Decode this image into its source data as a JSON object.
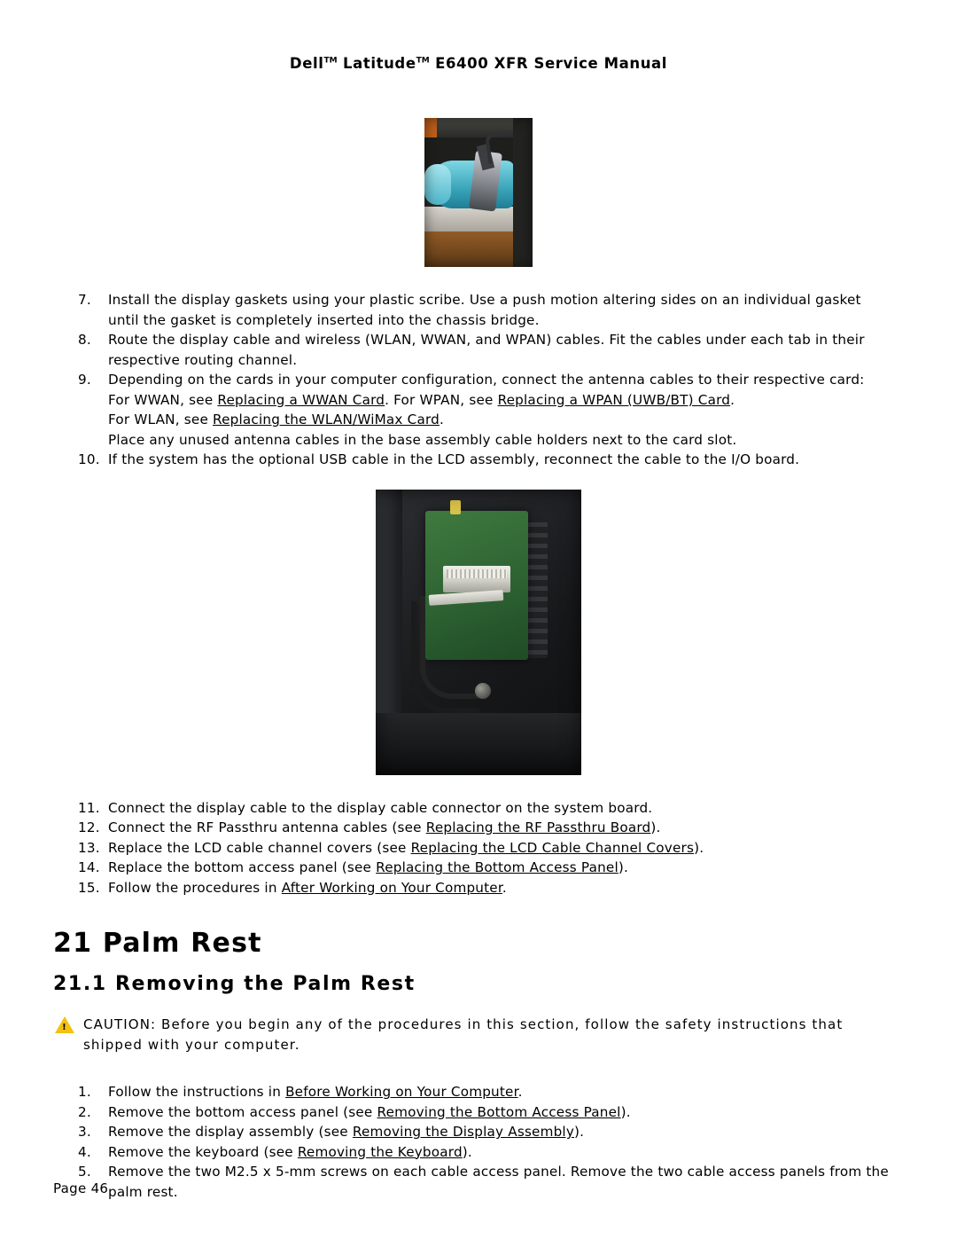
{
  "header": {
    "title_part1": "Dell",
    "tm1": "TM",
    "title_part2": "Latitude",
    "tm2": "TM",
    "title_part3": " E6400 XFR Service Manual"
  },
  "figures": {
    "fig1_name": "display-gasket-photo",
    "fig2_name": "io-board-usb-cable-photo"
  },
  "steps_group1": [
    {
      "num": "7.",
      "text": "Install the display gaskets using your plastic scribe.  Use a push motion altering sides on an individual gasket until the gasket is completely inserted into the chassis bridge."
    },
    {
      "num": "8.",
      "text": "Route the display cable and wireless (WLAN, WWAN, and WPAN) cables. Fit the cables under each tab in their respective routing channel."
    },
    {
      "num": "9.",
      "text_pre": "Depending on the cards in your computer configuration, connect the antenna cables to their respective card:",
      "line2_pre": "For WWAN, see ",
      "link1": "Replacing a WWAN Card",
      "line2_mid": ".  For WPAN, see ",
      "link2": "Replacing a WPAN (UWB/BT) Card",
      "line2_post": ".",
      "line3_pre": "For WLAN, see ",
      "link3": "Replacing the WLAN/WiMax Card",
      "line3_post": ".",
      "line4": "Place any unused antenna cables in the base assembly cable holders next to the card slot."
    },
    {
      "num": "10.",
      "text": "If the system has the optional USB cable in the LCD assembly, reconnect the cable to the I/O board."
    }
  ],
  "steps_group2": [
    {
      "num": "11.",
      "text": "Connect the display cable to the display cable connector on the system board."
    },
    {
      "num": "12.",
      "pre": "Connect the RF Passthru antenna cables (see ",
      "link": "Replacing the RF Passthru Board",
      "post": ")."
    },
    {
      "num": "13.",
      "pre": "Replace the LCD cable channel covers (see ",
      "link": "Replacing the LCD Cable Channel Covers",
      "post": ")."
    },
    {
      "num": "14.",
      "pre": "Replace the bottom access panel (see ",
      "link": "Replacing the Bottom Access Panel",
      "post": ")."
    },
    {
      "num": "15.",
      "pre": "Follow the procedures in ",
      "link": "After Working on Your Computer",
      "post": "."
    }
  ],
  "section": {
    "number": "21",
    "title": "Palm Rest",
    "subsection_number": "21.1",
    "subsection_title": "Removing the Palm Rest"
  },
  "caution": {
    "label": "CAUTION:",
    "text": " Before you begin any of the procedures in this section, follow the safety instructions that shipped with your computer."
  },
  "steps_group3": [
    {
      "num": "1.",
      "pre": "Follow the instructions in ",
      "link": "Before Working on Your Computer",
      "post": "."
    },
    {
      "num": "2.",
      "pre": "Remove the bottom access panel (see ",
      "link": "Removing the Bottom Access Panel",
      "post": ")."
    },
    {
      "num": "3.",
      "pre": "Remove the display assembly (see ",
      "link": "Removing the Display Assembly",
      "post": ")."
    },
    {
      "num": "4.",
      "pre": "Remove the keyboard (see ",
      "link": "Removing the Keyboard",
      "post": ")."
    },
    {
      "num": "5.",
      "pre": "Remove the two M2.5 x 5-mm screws on each cable access panel.  Remove the two cable access panels from the palm rest.",
      "link": "",
      "post": ""
    }
  ],
  "footer": {
    "page_label": "Page 46"
  }
}
